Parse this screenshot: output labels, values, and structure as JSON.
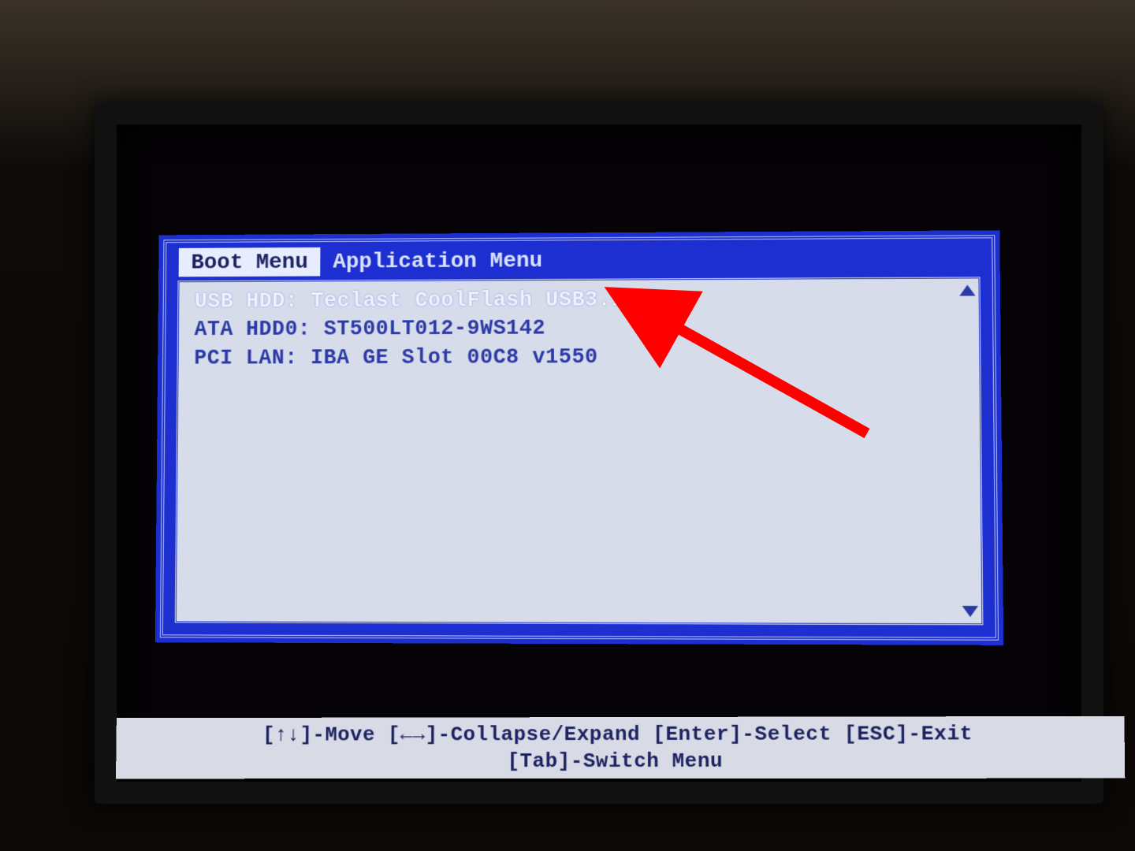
{
  "tabs": [
    {
      "label": "Boot Menu",
      "active": true
    },
    {
      "label": "Application Menu",
      "active": false
    }
  ],
  "boot_items": [
    {
      "label": "USB HDD: Teclast CoolFlash USB3.1",
      "selected": true
    },
    {
      "label": "ATA HDD0: ST500LT012-9WS142",
      "selected": false
    },
    {
      "label": "PCI LAN: IBA GE Slot 00C8 v1550",
      "selected": false
    }
  ],
  "help": {
    "line1": "[↑↓]-Move  [←→]-Collapse/Expand  [Enter]-Select  [ESC]-Exit",
    "line2": "[Tab]-Switch Menu"
  },
  "annotation": {
    "type": "arrow",
    "color": "#ff0000",
    "target": "boot_items.0"
  }
}
